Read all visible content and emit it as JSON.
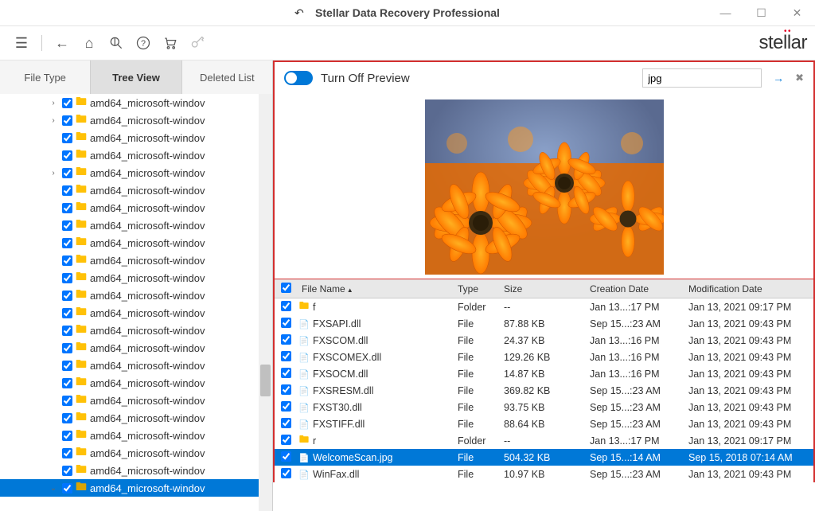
{
  "window": {
    "title": "Stellar Data Recovery Professional"
  },
  "logo_text": "stellar",
  "tabs": {
    "file_type": "File Type",
    "tree_view": "Tree View",
    "deleted_list": "Deleted List"
  },
  "preview": {
    "toggle_label": "Turn Off Preview",
    "search_value": "jpg"
  },
  "tree": {
    "items": [
      {
        "exp": ">",
        "name": "amd64_microsoft-windov"
      },
      {
        "exp": ">",
        "name": "amd64_microsoft-windov"
      },
      {
        "exp": "",
        "name": "amd64_microsoft-windov"
      },
      {
        "exp": "",
        "name": "amd64_microsoft-windov"
      },
      {
        "exp": ">",
        "name": "amd64_microsoft-windov"
      },
      {
        "exp": "",
        "name": "amd64_microsoft-windov"
      },
      {
        "exp": "",
        "name": "amd64_microsoft-windov"
      },
      {
        "exp": "",
        "name": "amd64_microsoft-windov"
      },
      {
        "exp": "",
        "name": "amd64_microsoft-windov"
      },
      {
        "exp": "",
        "name": "amd64_microsoft-windov"
      },
      {
        "exp": "",
        "name": "amd64_microsoft-windov"
      },
      {
        "exp": "",
        "name": "amd64_microsoft-windov"
      },
      {
        "exp": "",
        "name": "amd64_microsoft-windov"
      },
      {
        "exp": "",
        "name": "amd64_microsoft-windov"
      },
      {
        "exp": "",
        "name": "amd64_microsoft-windov"
      },
      {
        "exp": "",
        "name": "amd64_microsoft-windov"
      },
      {
        "exp": "",
        "name": "amd64_microsoft-windov"
      },
      {
        "exp": "",
        "name": "amd64_microsoft-windov"
      },
      {
        "exp": "",
        "name": "amd64_microsoft-windov"
      },
      {
        "exp": "",
        "name": "amd64_microsoft-windov"
      },
      {
        "exp": "",
        "name": "amd64_microsoft-windov"
      },
      {
        "exp": "",
        "name": "amd64_microsoft-windov"
      },
      {
        "exp": "v",
        "name": "amd64_microsoft-windov",
        "selected": true
      }
    ]
  },
  "table": {
    "headers": {
      "name": "File Name",
      "type": "Type",
      "size": "Size",
      "cd": "Creation Date",
      "md": "Modification Date"
    },
    "rows": [
      {
        "icon": "folder",
        "name": "f",
        "type": "Folder",
        "size": "--",
        "cd": "Jan 13...:17 PM",
        "md": "Jan 13, 2021 09:17 PM"
      },
      {
        "icon": "file",
        "name": "FXSAPI.dll",
        "type": "File",
        "size": "87.88 KB",
        "cd": "Sep 15...:23 AM",
        "md": "Jan 13, 2021 09:43 PM"
      },
      {
        "icon": "file",
        "name": "FXSCOM.dll",
        "type": "File",
        "size": "24.37 KB",
        "cd": "Jan 13...:16 PM",
        "md": "Jan 13, 2021 09:43 PM"
      },
      {
        "icon": "file",
        "name": "FXSCOMEX.dll",
        "type": "File",
        "size": "129.26 KB",
        "cd": "Jan 13...:16 PM",
        "md": "Jan 13, 2021 09:43 PM"
      },
      {
        "icon": "file",
        "name": "FXSOCM.dll",
        "type": "File",
        "size": "14.87 KB",
        "cd": "Jan 13...:16 PM",
        "md": "Jan 13, 2021 09:43 PM"
      },
      {
        "icon": "file",
        "name": "FXSRESM.dll",
        "type": "File",
        "size": "369.82 KB",
        "cd": "Sep 15...:23 AM",
        "md": "Jan 13, 2021 09:43 PM"
      },
      {
        "icon": "file",
        "name": "FXST30.dll",
        "type": "File",
        "size": "93.75 KB",
        "cd": "Sep 15...:23 AM",
        "md": "Jan 13, 2021 09:43 PM"
      },
      {
        "icon": "file",
        "name": "FXSTIFF.dll",
        "type": "File",
        "size": "88.64 KB",
        "cd": "Sep 15...:23 AM",
        "md": "Jan 13, 2021 09:43 PM"
      },
      {
        "icon": "folder",
        "name": "r",
        "type": "Folder",
        "size": "--",
        "cd": "Jan 13...:17 PM",
        "md": "Jan 13, 2021 09:17 PM"
      },
      {
        "icon": "file",
        "name": "WelcomeScan.jpg",
        "type": "File",
        "size": "504.32 KB",
        "cd": "Sep 15...:14 AM",
        "md": "Sep 15, 2018 07:14 AM",
        "selected": true
      },
      {
        "icon": "file",
        "name": "WinFax.dll",
        "type": "File",
        "size": "10.97 KB",
        "cd": "Sep 15...:23 AM",
        "md": "Jan 13, 2021 09:43 PM"
      }
    ]
  }
}
